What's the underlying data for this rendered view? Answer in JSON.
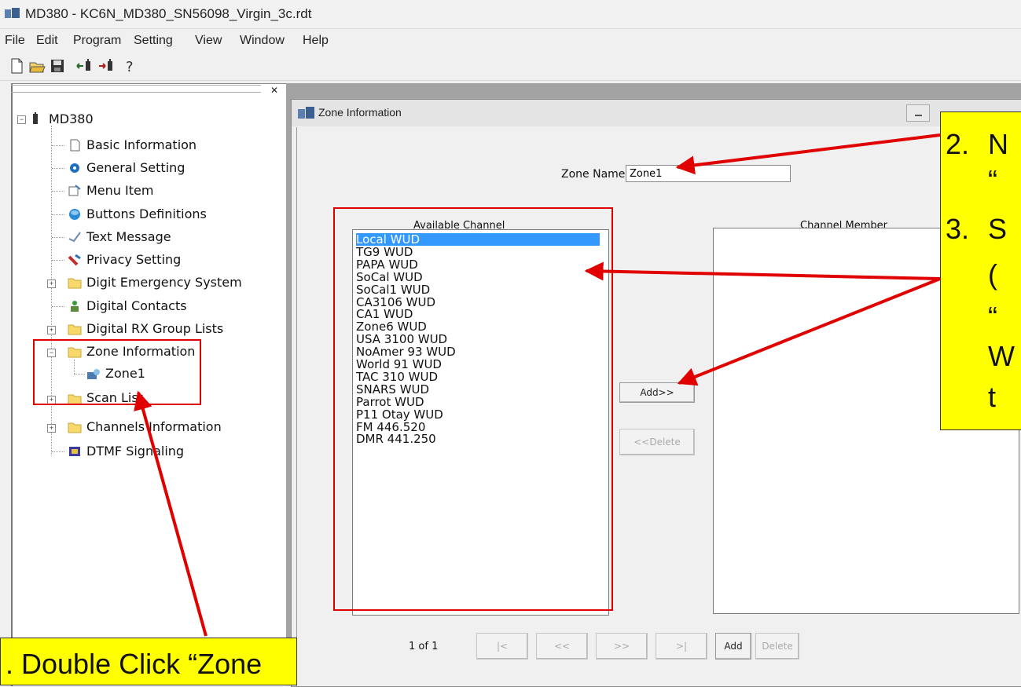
{
  "window_title": "MD380 - KC6N_MD380_SN56098_Virgin_3c.rdt",
  "menu": [
    "File",
    "Edit",
    "Program",
    "Setting",
    "View",
    "Window",
    "Help"
  ],
  "tree": {
    "root": "MD380",
    "items": [
      {
        "label": "Basic Information",
        "icon": "document-icon"
      },
      {
        "label": "General Setting",
        "icon": "settings-icon"
      },
      {
        "label": "Menu Item",
        "icon": "menu-icon"
      },
      {
        "label": "Buttons Definitions",
        "icon": "button-icon"
      },
      {
        "label": "Text Message",
        "icon": "message-icon"
      },
      {
        "label": "Privacy Setting",
        "icon": "privacy-icon"
      },
      {
        "label": "Digit Emergency System",
        "icon": "folder-icon"
      },
      {
        "label": "Digital Contacts",
        "icon": "contacts-icon"
      },
      {
        "label": "Digital RX Group Lists",
        "icon": "folder-icon"
      },
      {
        "label": "Zone Information",
        "icon": "folder-icon"
      },
      {
        "label": "Zone1",
        "icon": "zone-icon"
      },
      {
        "label": "Scan List",
        "icon": "folder-icon"
      },
      {
        "label": "Channels Information",
        "icon": "folder-icon"
      },
      {
        "label": "DTMF Signaling",
        "icon": "dtmf-icon"
      }
    ]
  },
  "zone_window": {
    "title": "Zone Information",
    "zone_name_label": "Zone Name",
    "zone_name_value": "Zone1",
    "available_label": "Available Channel",
    "member_label": "Channel Member",
    "available_channels": [
      "Local WUD",
      "TG9 WUD",
      "PAPA WUD",
      "SoCal WUD",
      "SoCal1 WUD",
      "CA3106 WUD",
      "CA1 WUD",
      "Zone6 WUD",
      "USA 3100 WUD",
      "NoAmer 93 WUD",
      "World 91 WUD",
      "TAC 310 WUD",
      "SNARS WUD",
      "Parrot WUD",
      "P11 Otay WUD",
      "FM 446.520",
      "DMR 441.250"
    ],
    "selected_channel": "Local WUD",
    "add_label": "Add>>",
    "delete_label": "<<Delete",
    "pager": "1 of 1",
    "nav_first": "|<",
    "nav_prev": "<<",
    "nav_next": ">>",
    "nav_last": ">|",
    "nav_add": "Add",
    "nav_delete": "Delete"
  },
  "callouts": {
    "step1": ". Double Click “Zone",
    "step2_num": "2.",
    "step2_line1": "N",
    "step2_line2": "“",
    "step3_num": "3.",
    "step3_line1": "S",
    "step3_line2": "(",
    "step3_line3": "“",
    "step3_line4": "W",
    "step3_line5": "t"
  },
  "colors": {
    "selection": "#3399ff",
    "callout": "#ffff00",
    "annotation": "#e00000"
  }
}
